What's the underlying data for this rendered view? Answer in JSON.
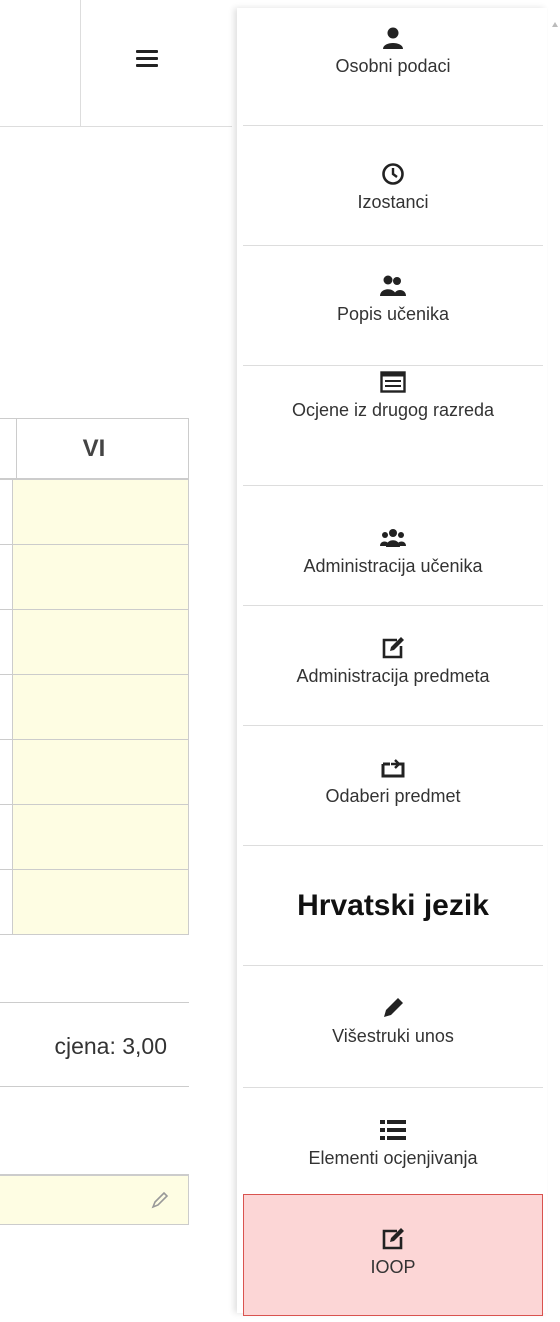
{
  "table": {
    "column_header": "VI",
    "average_label": "cjena: 3,00"
  },
  "menu": {
    "items": [
      {
        "label": "Osobni podaci",
        "icon": "user-icon"
      },
      {
        "label": "Izostanci",
        "icon": "clock-icon"
      },
      {
        "label": "Popis učenika",
        "icon": "users-icon"
      },
      {
        "label": "Ocjene iz drugog razreda",
        "icon": "list-card-icon"
      },
      {
        "label": "Administracija učenika",
        "icon": "group-icon"
      },
      {
        "label": "Administracija predmeta",
        "icon": "edit-icon"
      },
      {
        "label": "Odaberi predmet",
        "icon": "exchange-icon"
      },
      {
        "label": "Višestruki unos",
        "icon": "pencil-icon"
      },
      {
        "label": "Elementi ocjenjivanja",
        "icon": "list-icon"
      },
      {
        "label": "IOOP",
        "icon": "edit-icon"
      }
    ],
    "subject": "Hrvatski jezik",
    "active_color": "#fcd6d6",
    "active_border": "#d9534f"
  }
}
